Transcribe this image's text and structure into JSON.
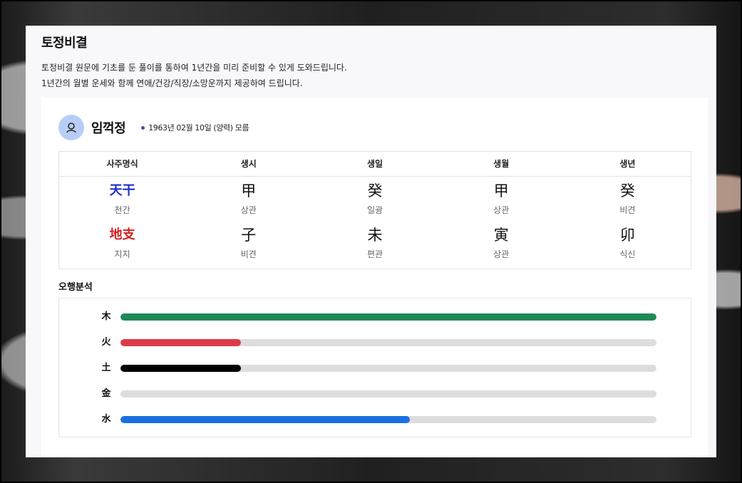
{
  "header": {
    "title": "토정비결",
    "desc_line1": "토정비결 원문에 기초를 둔 풀이를 통하여 1년간을 미리 준비할 수 있게 도와드립니다.",
    "desc_line2": "1년간의 월별 운세와 함께 연애/건강/직장/소망운까지 제공하여 드립니다."
  },
  "person": {
    "name": "임꺽정",
    "birth": "1963년 02월 10일 (양력) 모름",
    "avatar_icon": "user-icon",
    "dot_color": "#6b3fa0"
  },
  "saju": {
    "headers": [
      "사주명식",
      "생시",
      "생일",
      "생월",
      "생년"
    ],
    "cheongan": {
      "label_han": "天干",
      "label_sub": "천간",
      "cells": [
        {
          "han": "甲",
          "sub": "상관"
        },
        {
          "han": "癸",
          "sub": "일광"
        },
        {
          "han": "甲",
          "sub": "상관"
        },
        {
          "han": "癸",
          "sub": "비견"
        }
      ]
    },
    "jiji": {
      "label_han": "地支",
      "label_sub": "지지",
      "cells": [
        {
          "han": "子",
          "sub": "비견"
        },
        {
          "han": "未",
          "sub": "편관"
        },
        {
          "han": "寅",
          "sub": "상관"
        },
        {
          "han": "卯",
          "sub": "식신"
        }
      ]
    }
  },
  "ohaeng": {
    "title": "오행분석",
    "items": [
      {
        "label": "木",
        "value": 1.0,
        "color": "#1e8a57"
      },
      {
        "label": "火",
        "value": 0.225,
        "color": "#dc3b48"
      },
      {
        "label": "土",
        "value": 0.225,
        "color": "#000000"
      },
      {
        "label": "金",
        "value": 0.0,
        "color": "#999999"
      },
      {
        "label": "水",
        "value": 0.54,
        "color": "#1a6fe0"
      }
    ]
  }
}
